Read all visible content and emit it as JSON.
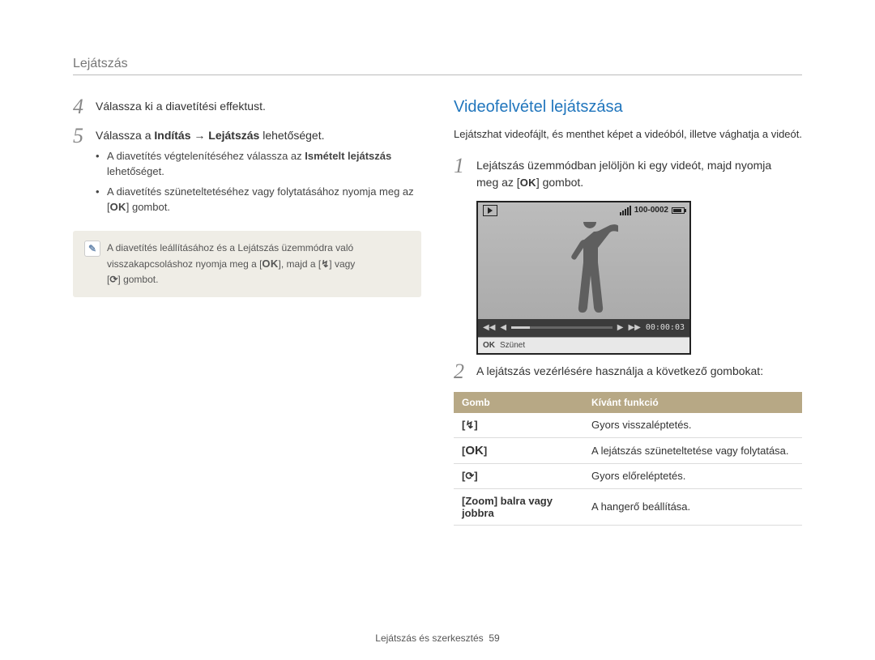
{
  "header": {
    "title": "Lejátszás"
  },
  "left": {
    "step4": {
      "num": "4",
      "text": "Válassza ki a diavetítési effektust."
    },
    "step5": {
      "num": "5",
      "text_prefix": "Válassza a ",
      "text_b1": "Indítás",
      "text_arrow": " → ",
      "text_b2": "Lejátszás",
      "text_suffix": " lehetőséget.",
      "bullet1_prefix": "A diavetítés végtelenítéséhez válassza az ",
      "bullet1_bold": "Ismételt lejátszás",
      "bullet1_suffix": " lehetőséget.",
      "bullet2_prefix": "A diavetítés szüneteltetéséhez vagy folytatásához nyomja meg az [",
      "bullet2_ok": "OK",
      "bullet2_suffix": "] gombot."
    },
    "note": {
      "line1": "A diavetítés leállításához és a Lejátszás üzemmódra való",
      "line2_prefix": "visszakapcsoláshoz nyomja meg a [",
      "ok": "OK",
      "line2_mid": "], majd a [",
      "flash": "↯",
      "line2_mid2": "] vagy",
      "line3_prefix": "[",
      "timer": "⟳",
      "line3_suffix": "] gombot."
    }
  },
  "right": {
    "title": "Videofelvétel lejátszása",
    "intro": "Lejátszhat videofájlt, és menthet képet a videóból, illetve vághatja a videót.",
    "step1": {
      "num": "1",
      "line1": "Lejátszás üzemmódban jelöljön ki egy videót, majd nyomja",
      "line2_prefix": "meg az [",
      "ok": "OK",
      "line2_suffix": "] gombot."
    },
    "step2": {
      "num": "2",
      "text": "A lejátszás vezérlésére használja a következő gombokat:"
    },
    "video": {
      "file_counter": "100-0002",
      "timecode": "00:00:03",
      "bottom_ok": "OK",
      "bottom_label": "Szünet"
    },
    "table": {
      "col1": "Gomb",
      "col2": "Kívánt funkció",
      "rows": [
        {
          "btn_open": "[",
          "btn_sym": "↯",
          "btn_close": "]",
          "desc": "Gyors visszaléptetés."
        },
        {
          "btn_open": "[",
          "btn_sym": "OK",
          "btn_close": "]",
          "desc": "A lejátszás szüneteltetése vagy folytatása."
        },
        {
          "btn_open": "[",
          "btn_sym": "⟳",
          "btn_close": "]",
          "desc": "Gyors előreléptetés."
        },
        {
          "btn_text": "[Zoom] balra vagy jobbra",
          "desc": "A hangerő beállítása."
        }
      ]
    }
  },
  "footer": {
    "chapter": "Lejátszás és szerkesztés",
    "page": "59"
  }
}
